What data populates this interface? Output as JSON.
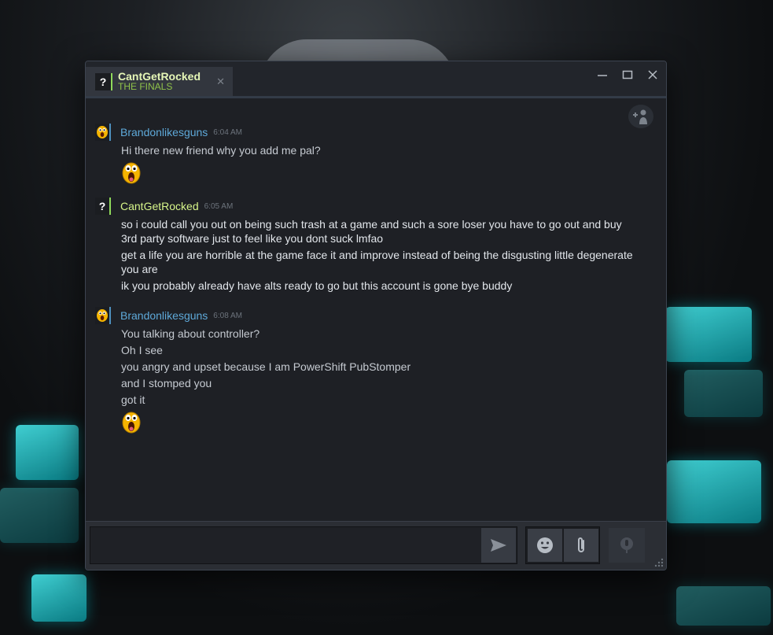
{
  "window": {
    "tab": {
      "avatar_glyph": "?",
      "name": "CantGetRocked",
      "game": "THE FINALS",
      "close_glyph": "✕"
    },
    "controls": [
      "minimize-icon",
      "maximize-icon",
      "close-icon"
    ]
  },
  "messages": [
    {
      "sender": "Brandonlikesguns",
      "time": "6:04 AM",
      "avatar_icon": "yellow-face-icon",
      "lines": [
        "Hi there new friend why you add me pal?"
      ],
      "emote": "screaming-face-emote-icon"
    },
    {
      "sender": "CantGetRocked",
      "time": "6:05 AM",
      "avatar_glyph": "?",
      "lines": [
        "so i could call you out on being such trash at a game and such a sore loser you have to go out and buy 3rd party software just to feel like you dont suck lmfao",
        "get a life you are horrible at the game face it and improve instead of being the disgusting little degenerate you are",
        "ik you probably already have alts ready to go but this account is gone bye buddy"
      ]
    },
    {
      "sender": "Brandonlikesguns",
      "time": "6:08 AM",
      "avatar_icon": "yellow-face-icon",
      "lines": [
        "You talking about controller?",
        "Oh I see",
        "you angry and upset because I am PowerShift PubStomper",
        "and I stomped you",
        "got it"
      ],
      "emote": "screaming-face-emote-icon"
    }
  ],
  "input": {
    "placeholder": "",
    "value": ""
  },
  "colors": {
    "friend_blue": "#5ea9d9",
    "friend_green": "#d7f58a",
    "in_game_green": "#8fc24a",
    "window_bg": "#1e2025"
  }
}
